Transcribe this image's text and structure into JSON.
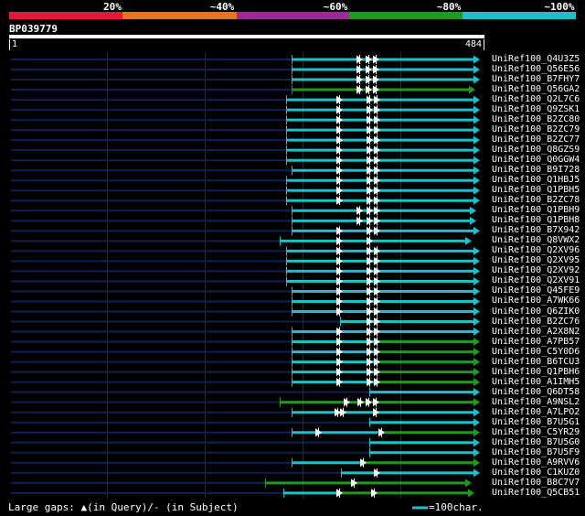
{
  "identity_scale": {
    "ticks": [
      "20%",
      "~40%",
      "~60%",
      "~80%",
      "~100%"
    ],
    "colors": [
      "#e8153a",
      "#e07720",
      "#9a2a9a",
      "#1f9a1f",
      "#1cc0c8"
    ]
  },
  "query": {
    "id": "BP039779",
    "start_label": "1",
    "end_label": "484"
  },
  "hits": [
    {
      "name": "UniRef100_Q4U3Z5",
      "start": 319,
      "end": 525,
      "color": "cyan",
      "marks": [
        393,
        403,
        411
      ]
    },
    {
      "name": "UniRef100_Q56E56",
      "start": 319,
      "end": 525,
      "color": "cyan",
      "marks": [
        393,
        403,
        411
      ]
    },
    {
      "name": "UniRef100_B7FHY7",
      "start": 319,
      "end": 525,
      "color": "cyan",
      "marks": [
        393,
        403,
        411
      ]
    },
    {
      "name": "UniRef100_Q56GA2",
      "start": 319,
      "end": 520,
      "color": "green",
      "marks": [
        393,
        403,
        411
      ]
    },
    {
      "name": "UniRef100_Q2L7C6",
      "start": 313,
      "end": 525,
      "color": "cyan",
      "marks": [
        371,
        404,
        412
      ]
    },
    {
      "name": "UniRef100_Q9ZSK1",
      "start": 313,
      "end": 525,
      "color": "cyan",
      "marks": [
        371,
        404,
        412
      ]
    },
    {
      "name": "UniRef100_B2ZC80",
      "start": 313,
      "end": 525,
      "color": "cyan",
      "marks": [
        371,
        404,
        412
      ]
    },
    {
      "name": "UniRef100_B2ZC79",
      "start": 313,
      "end": 525,
      "color": "cyan",
      "marks": [
        371,
        404,
        412
      ]
    },
    {
      "name": "UniRef100_B2ZC77",
      "start": 313,
      "end": 525,
      "color": "cyan",
      "marks": [
        371,
        404,
        412
      ]
    },
    {
      "name": "UniRef100_Q8GZS9",
      "start": 313,
      "end": 525,
      "color": "cyan",
      "marks": [
        371,
        404,
        412
      ]
    },
    {
      "name": "UniRef100_Q0GGW4",
      "start": 313,
      "end": 525,
      "color": "cyan",
      "marks": [
        371,
        404,
        412
      ]
    },
    {
      "name": "UniRef100_B9I728",
      "start": 319,
      "end": 525,
      "color": "cyan",
      "marks": [
        371,
        404,
        412
      ]
    },
    {
      "name": "UniRef100_Q1HBJ5",
      "start": 313,
      "end": 525,
      "color": "cyan",
      "marks": [
        371,
        404,
        412
      ]
    },
    {
      "name": "UniRef100_Q1PBH5",
      "start": 313,
      "end": 525,
      "color": "cyan",
      "marks": [
        371,
        404,
        412
      ]
    },
    {
      "name": "UniRef100_B2ZC78",
      "start": 313,
      "end": 525,
      "color": "cyan",
      "marks": [
        371,
        404,
        412
      ]
    },
    {
      "name": "UniRef100_Q1PBH9",
      "start": 319,
      "end": 521,
      "color": "cyan",
      "marks": [
        393,
        404,
        412
      ]
    },
    {
      "name": "UniRef100_Q1PBH8",
      "start": 319,
      "end": 521,
      "color": "cyan",
      "marks": [
        393,
        404,
        412
      ]
    },
    {
      "name": "UniRef100_B7X942",
      "start": 319,
      "end": 525,
      "color": "cyan",
      "marks": [
        371,
        404,
        412
      ]
    },
    {
      "name": "UniRef100_Q8VWX2",
      "start": 306,
      "end": 516,
      "color": "cyan",
      "marks": [
        371,
        404
      ]
    },
    {
      "name": "UniRef100_Q2XV96",
      "start": 313,
      "end": 525,
      "color": "cyan",
      "marks": [
        371,
        404,
        412
      ]
    },
    {
      "name": "UniRef100_Q2XV95",
      "start": 313,
      "end": 525,
      "color": "cyan",
      "marks": [
        371,
        404,
        412
      ]
    },
    {
      "name": "UniRef100_Q2XV92",
      "start": 313,
      "end": 525,
      "color": "cyan",
      "marks": [
        371,
        404,
        412
      ]
    },
    {
      "name": "UniRef100_Q2XV91",
      "start": 313,
      "end": 525,
      "color": "cyan",
      "marks": [
        371,
        404,
        412
      ]
    },
    {
      "name": "UniRef100_Q45FE9",
      "start": 319,
      "end": 525,
      "color": "cyan",
      "marks": [
        371,
        404,
        412
      ]
    },
    {
      "name": "UniRef100_A7WK66",
      "start": 319,
      "end": 525,
      "color": "cyan",
      "marks": [
        371,
        404,
        412
      ]
    },
    {
      "name": "UniRef100_Q6ZIK0",
      "start": 319,
      "end": 525,
      "color": "cyan",
      "marks": [
        371,
        404,
        412
      ]
    },
    {
      "name": "UniRef100_B2ZC76",
      "start": 372,
      "end": 525,
      "color": "cyan",
      "marks": [
        404,
        412
      ]
    },
    {
      "name": "UniRef100_A2X8N2",
      "start": 319,
      "end": 525,
      "color": "cyan",
      "marks": [
        371,
        404,
        412
      ]
    },
    {
      "name": "UniRef100_A7PB57",
      "start": 319,
      "end": 525,
      "color": "mixed",
      "split": 413,
      "marks": [
        371,
        404,
        412
      ]
    },
    {
      "name": "UniRef100_C5Y0D6",
      "start": 319,
      "end": 525,
      "color": "mixed",
      "split": 413,
      "marks": [
        371,
        404,
        412
      ]
    },
    {
      "name": "UniRef100_B6TCU3",
      "start": 319,
      "end": 525,
      "color": "mixed",
      "split": 413,
      "marks": [
        371,
        404,
        412
      ]
    },
    {
      "name": "UniRef100_Q1PBH6",
      "start": 319,
      "end": 525,
      "color": "mixed",
      "split": 413,
      "marks": [
        371,
        404,
        412
      ]
    },
    {
      "name": "UniRef100_A1IMH5",
      "start": 319,
      "end": 525,
      "color": "mixed",
      "split": 413,
      "marks": [
        371,
        404,
        412
      ]
    },
    {
      "name": "UniRef100_Q6DT58",
      "start": 404,
      "end": 525,
      "color": "cyan",
      "marks": []
    },
    {
      "name": "UniRef100_A9NSL2",
      "start": 306,
      "end": 525,
      "color": "green",
      "marks": [
        379,
        394,
        403,
        411
      ]
    },
    {
      "name": "UniRef100_A7LPO2",
      "start": 319,
      "end": 525,
      "color": "cyan",
      "marks": [
        369,
        375,
        411
      ]
    },
    {
      "name": "UniRef100_B7U5G1",
      "start": 404,
      "end": 525,
      "color": "cyan",
      "marks": []
    },
    {
      "name": "UniRef100_C5YR29",
      "start": 319,
      "end": 525,
      "color": "mixed",
      "split": 413,
      "marks": [
        348,
        417
      ]
    },
    {
      "name": "UniRef100_B7U5G0",
      "start": 404,
      "end": 525,
      "color": "cyan",
      "marks": []
    },
    {
      "name": "UniRef100_B7U5F9",
      "start": 404,
      "end": 525,
      "color": "cyan",
      "marks": []
    },
    {
      "name": "UniRef100_A9RVV6",
      "start": 319,
      "end": 525,
      "color": "mixed",
      "split": 399,
      "marks": [
        397
      ]
    },
    {
      "name": "UniRef100_C1KUZ0",
      "start": 373,
      "end": 525,
      "color": "cyan",
      "marks": [
        412
      ]
    },
    {
      "name": "UniRef100_B8C7V7",
      "start": 290,
      "end": 516,
      "color": "green",
      "marks": [
        387
      ]
    },
    {
      "name": "UniRef100_Q5CB51",
      "start": 310,
      "end": 519,
      "color": "mixed",
      "split": 373,
      "marks": [
        371,
        409
      ]
    }
  ],
  "footer": {
    "gaps_legend": "Large gaps: ▲(in Query)/- (in Subject)",
    "scale_legend": "=100char."
  }
}
